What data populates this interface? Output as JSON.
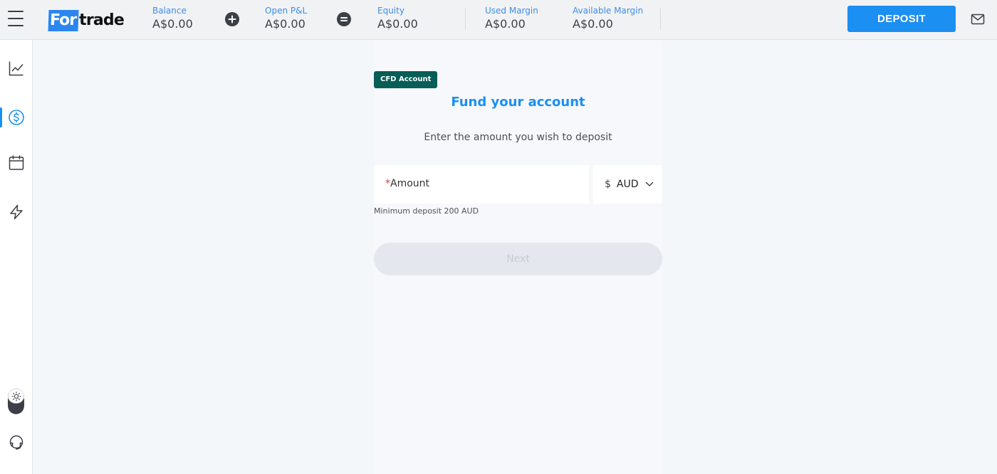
{
  "header": {
    "logo_text_highlight": "For",
    "logo_text_rest": "trade",
    "metrics": [
      {
        "label": "Balance",
        "value": "A$0.00"
      },
      {
        "label": "Open P&L",
        "value": "A$0.00"
      },
      {
        "label": "Equity",
        "value": "A$0.00"
      },
      {
        "label": "Used Margin",
        "value": "A$0.00"
      },
      {
        "label": "Available Margin",
        "value": "A$0.00"
      }
    ],
    "deposit_label": "DEPOSIT"
  },
  "sidebar": {
    "items": [
      {
        "name": "charts",
        "icon": "chart-line-icon"
      },
      {
        "name": "funding",
        "icon": "dollar-circle-icon",
        "active": true
      },
      {
        "name": "calendar",
        "icon": "calendar-icon"
      },
      {
        "name": "signals",
        "icon": "lightning-icon"
      }
    ],
    "theme_icon": "sun-icon",
    "support_icon": "headset-icon"
  },
  "form": {
    "badge": "CFD Account",
    "title": "Fund your account",
    "subtitle": "Enter the amount you wish to deposit",
    "amount_required_mark": "*",
    "amount_label": "Amount",
    "currency_symbol": "$",
    "currency_code": "AUD",
    "min_note": "Minimum deposit 200 AUD",
    "next_label": "Next"
  },
  "colors": {
    "accent": "#1b8ff2",
    "badge_bg": "#075e56",
    "required": "#e0342f"
  }
}
